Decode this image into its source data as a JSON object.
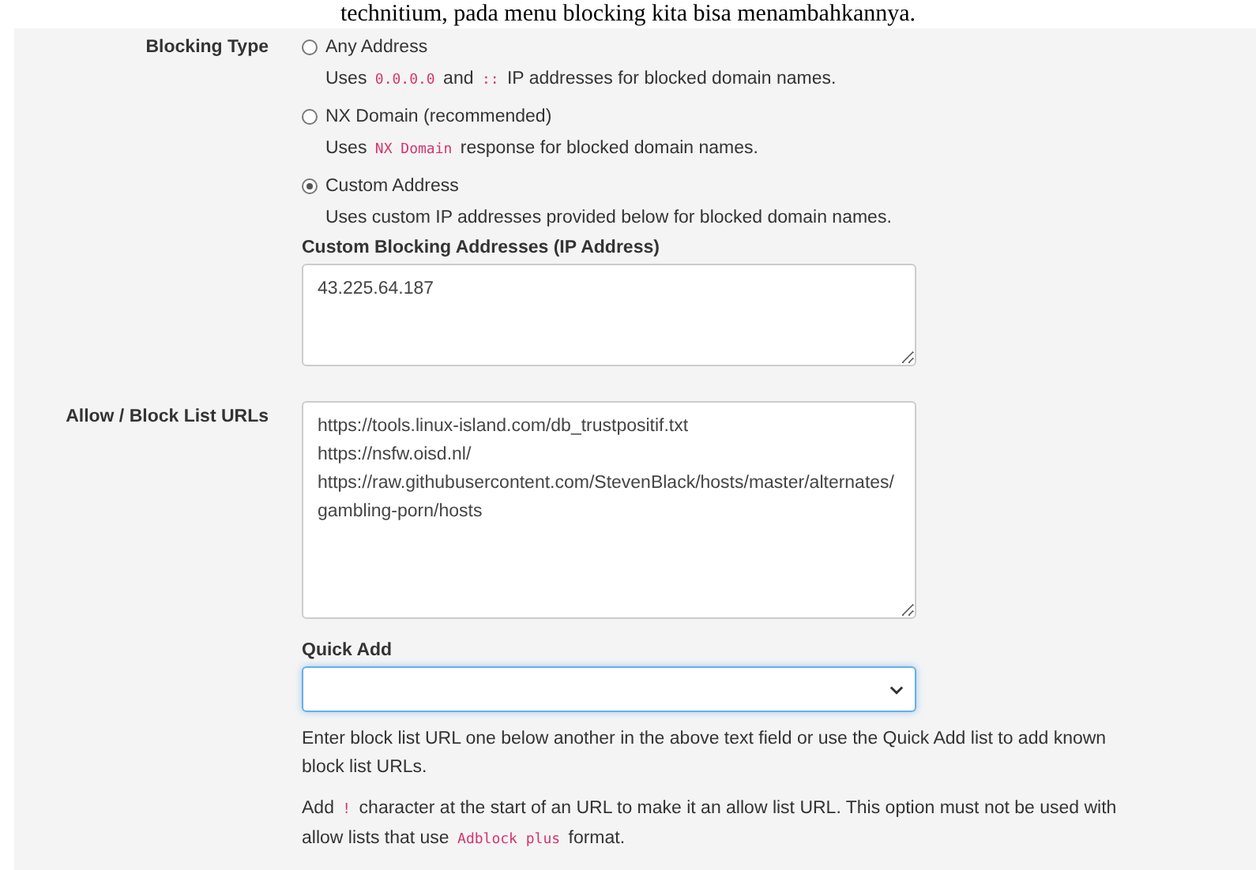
{
  "caption": "technitium, pada menu blocking kita bisa menambahkannya.",
  "blocking_type": {
    "label": "Blocking Type",
    "options": [
      {
        "label": "Any Address",
        "selected": false,
        "description": [
          {
            "kind": "text",
            "text": "Uses"
          },
          {
            "kind": "code",
            "text": "0.0.0.0"
          },
          {
            "kind": "text",
            "text": "and"
          },
          {
            "kind": "code",
            "text": "::"
          },
          {
            "kind": "text",
            "text": "IP addresses for blocked domain names."
          }
        ]
      },
      {
        "label": "NX Domain (recommended)",
        "selected": false,
        "description": [
          {
            "kind": "text",
            "text": "Uses"
          },
          {
            "kind": "code",
            "text": "NX Domain"
          },
          {
            "kind": "text",
            "text": "response for blocked domain names."
          }
        ]
      },
      {
        "label": "Custom Address",
        "selected": true,
        "description": [
          {
            "kind": "text",
            "text": "Uses custom IP addresses provided below for blocked domain names."
          }
        ]
      }
    ],
    "custom_addresses": {
      "label": "Custom Blocking Addresses (IP Address)",
      "value": "43.225.64.187"
    }
  },
  "block_lists": {
    "label": "Allow / Block List URLs",
    "value": "https://tools.linux-island.com/db_trustpositif.txt\nhttps://nsfw.oisd.nl/\nhttps://raw.githubusercontent.com/StevenBlack/hosts/master/alternates/gambling-porn/hosts",
    "quick_add": {
      "label": "Quick Add"
    },
    "help": [
      [
        {
          "kind": "text",
          "text": "Enter block list URL one below another in the above text field or use the Quick Add list to add known block list URLs."
        }
      ],
      [
        {
          "kind": "text",
          "text": "Add"
        },
        {
          "kind": "code",
          "text": "!"
        },
        {
          "kind": "text",
          "text": "character at the start of an URL to make it an allow list URL. This option must not be used with allow lists that use"
        },
        {
          "kind": "code",
          "text": "Adblock plus"
        },
        {
          "kind": "text",
          "text": "format."
        }
      ]
    ]
  }
}
